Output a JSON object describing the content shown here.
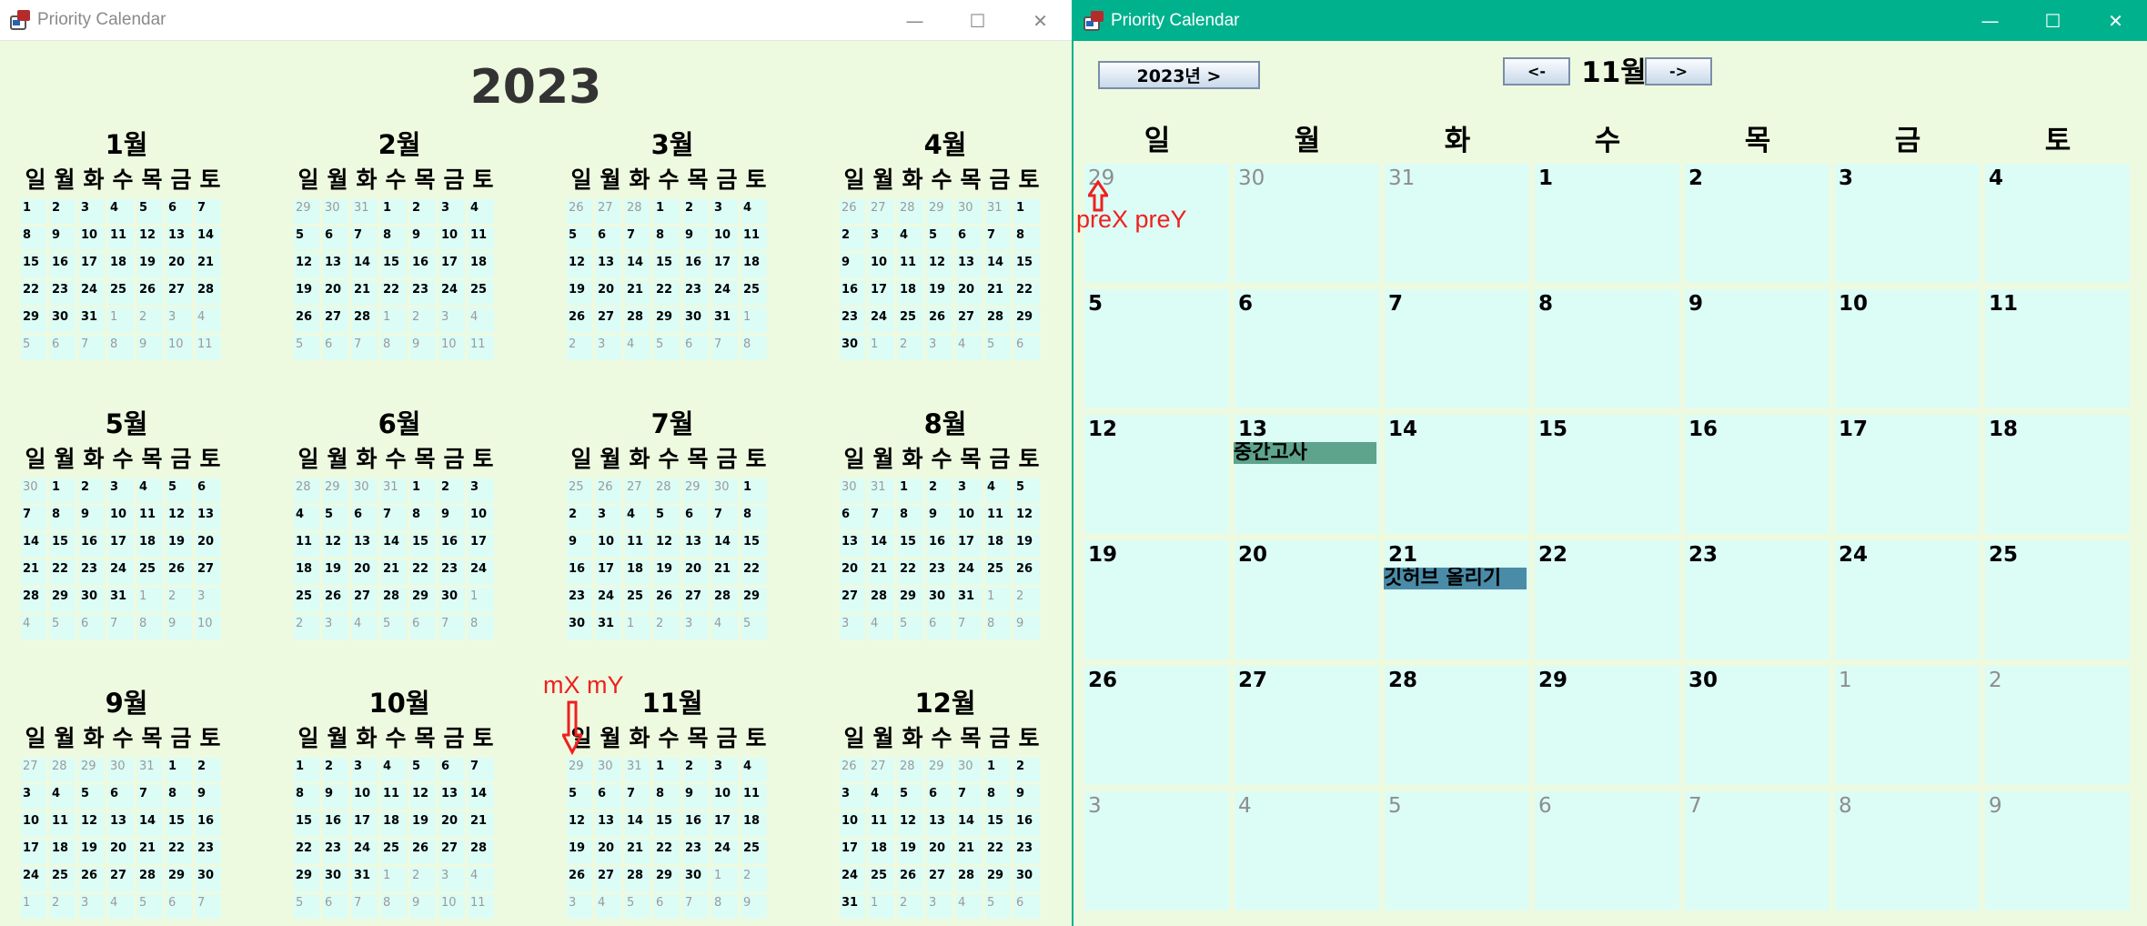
{
  "left_window": {
    "title": "Priority Calendar",
    "controls": {
      "minimize": "—",
      "maximize": "☐",
      "close": "✕"
    },
    "year": "2023",
    "dow": [
      "일",
      "월",
      "화",
      "수",
      "목",
      "금",
      "토"
    ],
    "months": [
      {
        "title": "1월",
        "start": 0,
        "days": 31,
        "prev_days": 31
      },
      {
        "title": "2월",
        "start": 3,
        "days": 28,
        "prev_days": 31
      },
      {
        "title": "3월",
        "start": 3,
        "days": 31,
        "prev_days": 28
      },
      {
        "title": "4월",
        "start": 6,
        "days": 30,
        "prev_days": 31
      },
      {
        "title": "5월",
        "start": 1,
        "days": 31,
        "prev_days": 30
      },
      {
        "title": "6월",
        "start": 4,
        "days": 30,
        "prev_days": 31
      },
      {
        "title": "7월",
        "start": 6,
        "days": 31,
        "prev_days": 30
      },
      {
        "title": "8월",
        "start": 2,
        "days": 31,
        "prev_days": 31
      },
      {
        "title": "9월",
        "start": 5,
        "days": 30,
        "prev_days": 31
      },
      {
        "title": "10월",
        "start": 0,
        "days": 31,
        "prev_days": 30
      },
      {
        "title": "11월",
        "start": 3,
        "days": 30,
        "prev_days": 31
      },
      {
        "title": "12월",
        "start": 5,
        "days": 31,
        "prev_days": 30
      }
    ],
    "annotation": "mX mY"
  },
  "right_window": {
    "title": "Priority Calendar",
    "controls": {
      "minimize": "—",
      "maximize": "☐",
      "close": "✕"
    },
    "year_button": "2023년 >",
    "prev_button": "<-",
    "next_button": "->",
    "month_label": "11월",
    "dow": [
      "일",
      "월",
      "화",
      "수",
      "목",
      "금",
      "토"
    ],
    "start": 3,
    "days": 30,
    "prev_days": 31,
    "events": [
      {
        "day": 13,
        "title": "중간고사",
        "color": "#5ea38c"
      },
      {
        "day": 21,
        "title": "깃허브 올리기",
        "color": "#4a8ca8"
      }
    ],
    "annotation": "preX preY",
    "colors": {
      "titlebar": "#00b18e",
      "cell": "#dcfcf6",
      "background": "#eefadf"
    }
  }
}
